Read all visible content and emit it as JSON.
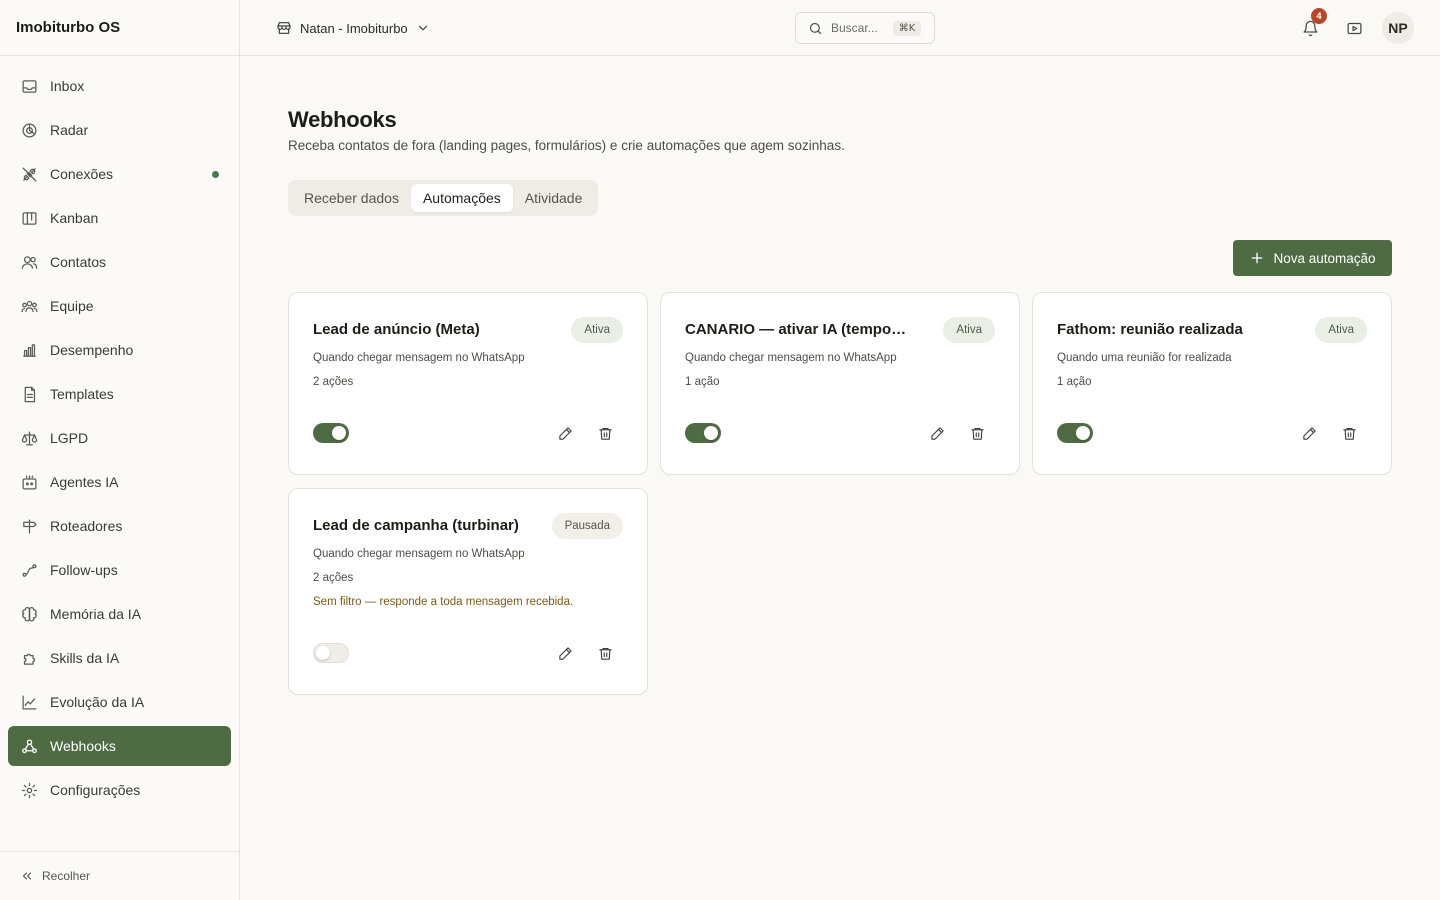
{
  "app": {
    "title": "Imobiturbo OS"
  },
  "sidebar": {
    "items": [
      {
        "label": "Inbox",
        "icon": "inbox-icon"
      },
      {
        "label": "Radar",
        "icon": "radar-icon"
      },
      {
        "label": "Conexões",
        "icon": "plug-icon",
        "status_dot": true
      },
      {
        "label": "Kanban",
        "icon": "kanban-icon"
      },
      {
        "label": "Contatos",
        "icon": "contacts-icon"
      },
      {
        "label": "Equipe",
        "icon": "team-icon"
      },
      {
        "label": "Desempenho",
        "icon": "bar-chart-icon"
      },
      {
        "label": "Templates",
        "icon": "document-icon"
      },
      {
        "label": "LGPD",
        "icon": "scale-icon"
      },
      {
        "label": "Agentes IA",
        "icon": "bot-icon"
      },
      {
        "label": "Roteadores",
        "icon": "signpost-icon"
      },
      {
        "label": "Follow-ups",
        "icon": "route-icon"
      },
      {
        "label": "Memória da IA",
        "icon": "brain-icon"
      },
      {
        "label": "Skills da IA",
        "icon": "puzzle-icon"
      },
      {
        "label": "Evolução da IA",
        "icon": "trend-icon"
      },
      {
        "label": "Webhooks",
        "icon": "webhook-icon",
        "active": true
      },
      {
        "label": "Configurações",
        "icon": "gear-icon"
      }
    ],
    "collapse_label": "Recolher"
  },
  "topbar": {
    "workspace": "Natan - Imobiturbo",
    "search_placeholder": "Buscar...",
    "search_shortcut": "⌘K",
    "notifications_count": "4",
    "avatar_initials": "NP"
  },
  "page": {
    "title": "Webhooks",
    "subtitle": "Receba contatos de fora (landing pages, formulários) e crie automações que agem sozinhas.",
    "tabs": [
      {
        "label": "Receber dados"
      },
      {
        "label": "Automações",
        "active": true
      },
      {
        "label": "Atividade"
      }
    ],
    "new_button": "Nova automação"
  },
  "automations": [
    {
      "title": "Lead de anúncio (Meta)",
      "status": "Ativa",
      "trigger": "Quando chegar mensagem no WhatsApp",
      "actions": "2 ações",
      "enabled": true
    },
    {
      "title": "CANARIO — ativar IA (temporari...",
      "status": "Ativa",
      "trigger": "Quando chegar mensagem no WhatsApp",
      "actions": "1 ação",
      "enabled": true
    },
    {
      "title": "Fathom: reunião realizada",
      "status": "Ativa",
      "trigger": "Quando uma reunião for realizada",
      "actions": "1 ação",
      "enabled": true
    },
    {
      "title": "Lead de campanha (turbinar)",
      "status": "Pausada",
      "trigger": "Quando chegar mensagem no WhatsApp",
      "actions": "2 ações",
      "warning": "Sem filtro — responde a toda mensagem recebida.",
      "enabled": false
    }
  ],
  "colors": {
    "accent": "#4e6b44",
    "badge": "#b5472c",
    "background": "#faf9f6"
  }
}
